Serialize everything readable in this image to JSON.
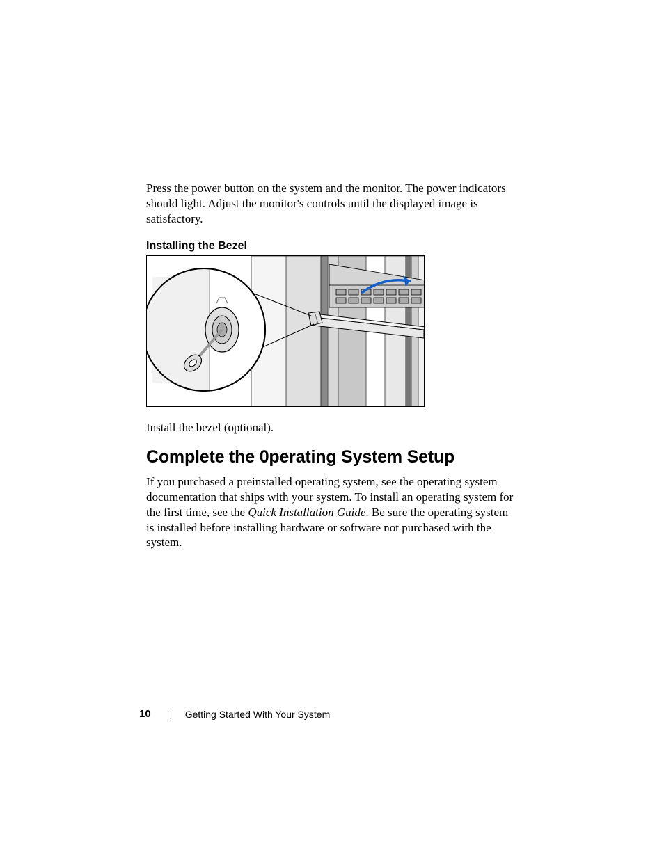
{
  "body": {
    "intro_para": "Press the power button on the system and the monitor. The power indicators should light. Adjust the monitor's controls until the displayed image is satisfactory.",
    "sub_heading": "Installing the Bezel",
    "caption": "Install the bezel (optional).",
    "h2": "Complete the 0perating System Setup",
    "os_para_1": "If you purchased a preinstalled operating system, see the operating system documentation that ships with your system. To install an operating system for the first time, see the ",
    "os_para_italic": "Quick Installation Guide",
    "os_para_2": ". Be sure the operating system is installed before installing hardware or software not purchased with the system."
  },
  "footer": {
    "page_number": "10",
    "section_title": "Getting Started With Your System"
  }
}
